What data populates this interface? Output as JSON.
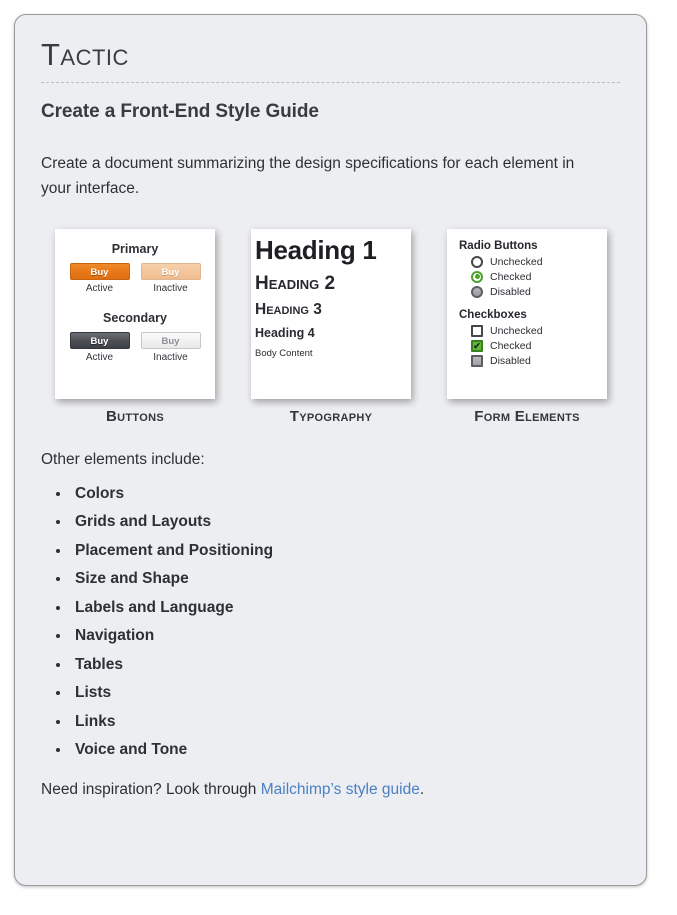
{
  "header": {
    "kicker": "Tactic",
    "title": "Create a Front-End Style Guide",
    "lead": "Create a document summarizing the design specifications for each element in your interface."
  },
  "cards": {
    "buttons": {
      "caption": "Buttons",
      "groups": [
        {
          "title": "Primary",
          "buttons": [
            {
              "text": "Buy",
              "state": "Active"
            },
            {
              "text": "Buy",
              "state": "Inactive"
            }
          ]
        },
        {
          "title": "Secondary",
          "buttons": [
            {
              "text": "Buy",
              "state": "Active"
            },
            {
              "text": "Buy",
              "state": "Inactive"
            }
          ]
        }
      ]
    },
    "typography": {
      "caption": "Typography",
      "samples": {
        "h1": "Heading 1",
        "h2": "Heading 2",
        "h3": "Heading 3",
        "h4": "Heading 4",
        "body": "Body Content"
      }
    },
    "form_elements": {
      "caption": "Form Elements",
      "radio_title": "Radio Buttons",
      "radios": [
        "Unchecked",
        "Checked",
        "Disabled"
      ],
      "checkbox_title": "Checkboxes",
      "checkboxes": [
        "Unchecked",
        "Checked",
        "Disabled"
      ],
      "check_glyph": "✔"
    }
  },
  "other": {
    "label": "Other elements include:",
    "items": [
      "Colors",
      "Grids and Layouts",
      "Placement and Positioning",
      "Size and Shape",
      "Labels and Language",
      "Navigation",
      "Tables",
      "Lists",
      "Links",
      "Voice and Tone"
    ]
  },
  "footer": {
    "prefix": "Need inspiration? Look through ",
    "link_text": "Mailchimp’s style guide",
    "suffix": "."
  },
  "colors": {
    "page_bg": "#edeef1",
    "primary_orange": "#e8781a",
    "primary_orange_inactive": "#f0bd8e",
    "secondary_dark": "#4a4d53",
    "green": "#4aa32a",
    "checkbox_green": "#5cbb35",
    "link_blue": "#4a80c4",
    "text": "#2f3036"
  }
}
